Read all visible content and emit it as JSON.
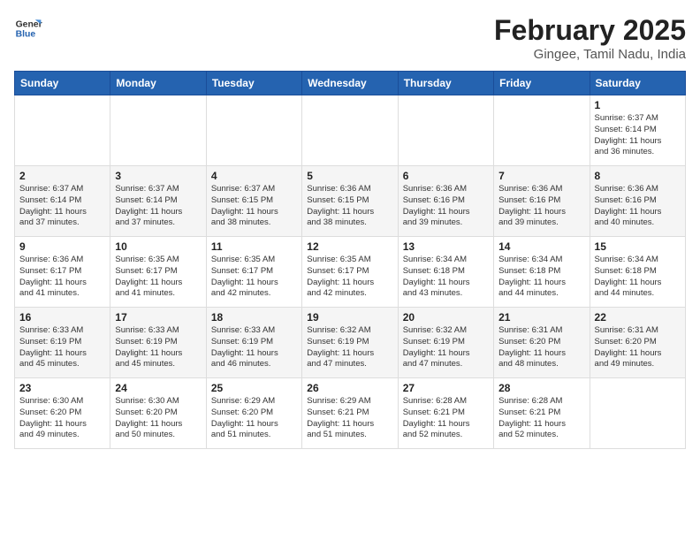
{
  "logo": {
    "text_general": "General",
    "text_blue": "Blue"
  },
  "title": "February 2025",
  "subtitle": "Gingee, Tamil Nadu, India",
  "weekdays": [
    "Sunday",
    "Monday",
    "Tuesday",
    "Wednesday",
    "Thursday",
    "Friday",
    "Saturday"
  ],
  "weeks": [
    [
      {
        "day": "",
        "info": ""
      },
      {
        "day": "",
        "info": ""
      },
      {
        "day": "",
        "info": ""
      },
      {
        "day": "",
        "info": ""
      },
      {
        "day": "",
        "info": ""
      },
      {
        "day": "",
        "info": ""
      },
      {
        "day": "1",
        "info": "Sunrise: 6:37 AM\nSunset: 6:14 PM\nDaylight: 11 hours\nand 36 minutes."
      }
    ],
    [
      {
        "day": "2",
        "info": "Sunrise: 6:37 AM\nSunset: 6:14 PM\nDaylight: 11 hours\nand 37 minutes."
      },
      {
        "day": "3",
        "info": "Sunrise: 6:37 AM\nSunset: 6:14 PM\nDaylight: 11 hours\nand 37 minutes."
      },
      {
        "day": "4",
        "info": "Sunrise: 6:37 AM\nSunset: 6:15 PM\nDaylight: 11 hours\nand 38 minutes."
      },
      {
        "day": "5",
        "info": "Sunrise: 6:36 AM\nSunset: 6:15 PM\nDaylight: 11 hours\nand 38 minutes."
      },
      {
        "day": "6",
        "info": "Sunrise: 6:36 AM\nSunset: 6:16 PM\nDaylight: 11 hours\nand 39 minutes."
      },
      {
        "day": "7",
        "info": "Sunrise: 6:36 AM\nSunset: 6:16 PM\nDaylight: 11 hours\nand 39 minutes."
      },
      {
        "day": "8",
        "info": "Sunrise: 6:36 AM\nSunset: 6:16 PM\nDaylight: 11 hours\nand 40 minutes."
      }
    ],
    [
      {
        "day": "9",
        "info": "Sunrise: 6:36 AM\nSunset: 6:17 PM\nDaylight: 11 hours\nand 41 minutes."
      },
      {
        "day": "10",
        "info": "Sunrise: 6:35 AM\nSunset: 6:17 PM\nDaylight: 11 hours\nand 41 minutes."
      },
      {
        "day": "11",
        "info": "Sunrise: 6:35 AM\nSunset: 6:17 PM\nDaylight: 11 hours\nand 42 minutes."
      },
      {
        "day": "12",
        "info": "Sunrise: 6:35 AM\nSunset: 6:17 PM\nDaylight: 11 hours\nand 42 minutes."
      },
      {
        "day": "13",
        "info": "Sunrise: 6:34 AM\nSunset: 6:18 PM\nDaylight: 11 hours\nand 43 minutes."
      },
      {
        "day": "14",
        "info": "Sunrise: 6:34 AM\nSunset: 6:18 PM\nDaylight: 11 hours\nand 44 minutes."
      },
      {
        "day": "15",
        "info": "Sunrise: 6:34 AM\nSunset: 6:18 PM\nDaylight: 11 hours\nand 44 minutes."
      }
    ],
    [
      {
        "day": "16",
        "info": "Sunrise: 6:33 AM\nSunset: 6:19 PM\nDaylight: 11 hours\nand 45 minutes."
      },
      {
        "day": "17",
        "info": "Sunrise: 6:33 AM\nSunset: 6:19 PM\nDaylight: 11 hours\nand 45 minutes."
      },
      {
        "day": "18",
        "info": "Sunrise: 6:33 AM\nSunset: 6:19 PM\nDaylight: 11 hours\nand 46 minutes."
      },
      {
        "day": "19",
        "info": "Sunrise: 6:32 AM\nSunset: 6:19 PM\nDaylight: 11 hours\nand 47 minutes."
      },
      {
        "day": "20",
        "info": "Sunrise: 6:32 AM\nSunset: 6:19 PM\nDaylight: 11 hours\nand 47 minutes."
      },
      {
        "day": "21",
        "info": "Sunrise: 6:31 AM\nSunset: 6:20 PM\nDaylight: 11 hours\nand 48 minutes."
      },
      {
        "day": "22",
        "info": "Sunrise: 6:31 AM\nSunset: 6:20 PM\nDaylight: 11 hours\nand 49 minutes."
      }
    ],
    [
      {
        "day": "23",
        "info": "Sunrise: 6:30 AM\nSunset: 6:20 PM\nDaylight: 11 hours\nand 49 minutes."
      },
      {
        "day": "24",
        "info": "Sunrise: 6:30 AM\nSunset: 6:20 PM\nDaylight: 11 hours\nand 50 minutes."
      },
      {
        "day": "25",
        "info": "Sunrise: 6:29 AM\nSunset: 6:20 PM\nDaylight: 11 hours\nand 51 minutes."
      },
      {
        "day": "26",
        "info": "Sunrise: 6:29 AM\nSunset: 6:21 PM\nDaylight: 11 hours\nand 51 minutes."
      },
      {
        "day": "27",
        "info": "Sunrise: 6:28 AM\nSunset: 6:21 PM\nDaylight: 11 hours\nand 52 minutes."
      },
      {
        "day": "28",
        "info": "Sunrise: 6:28 AM\nSunset: 6:21 PM\nDaylight: 11 hours\nand 52 minutes."
      },
      {
        "day": "",
        "info": ""
      }
    ]
  ]
}
